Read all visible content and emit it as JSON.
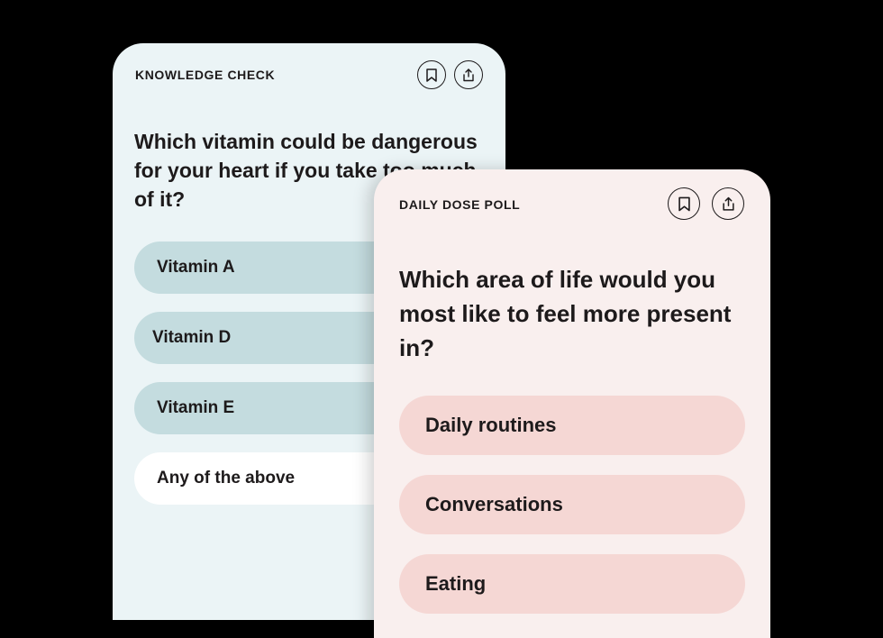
{
  "knowledge_check": {
    "eyebrow": "KNOWLEDGE CHECK",
    "question": "Which vitamin could be dangerous for your heart if you take too much of it?",
    "options": [
      {
        "label": "Vitamin A"
      },
      {
        "label": "Vitamin D"
      },
      {
        "label": "Vitamin E"
      },
      {
        "label": "Any of the above"
      }
    ],
    "icons": {
      "bookmark": "bookmark-icon",
      "share": "share-icon"
    },
    "colors": {
      "card_bg": "#ebf4f6",
      "option_bg": "#c4dcdf",
      "selected_bg": "#ffffff"
    }
  },
  "daily_dose_poll": {
    "eyebrow": "DAILY DOSE POLL",
    "question": "Which area of life would you most like to feel more present in?",
    "options": [
      {
        "label": "Daily routines"
      },
      {
        "label": "Conversations"
      },
      {
        "label": "Eating"
      }
    ],
    "icons": {
      "bookmark": "bookmark-icon",
      "share": "share-icon"
    },
    "colors": {
      "card_bg": "#f9efee",
      "option_bg": "#f5d7d4"
    }
  }
}
